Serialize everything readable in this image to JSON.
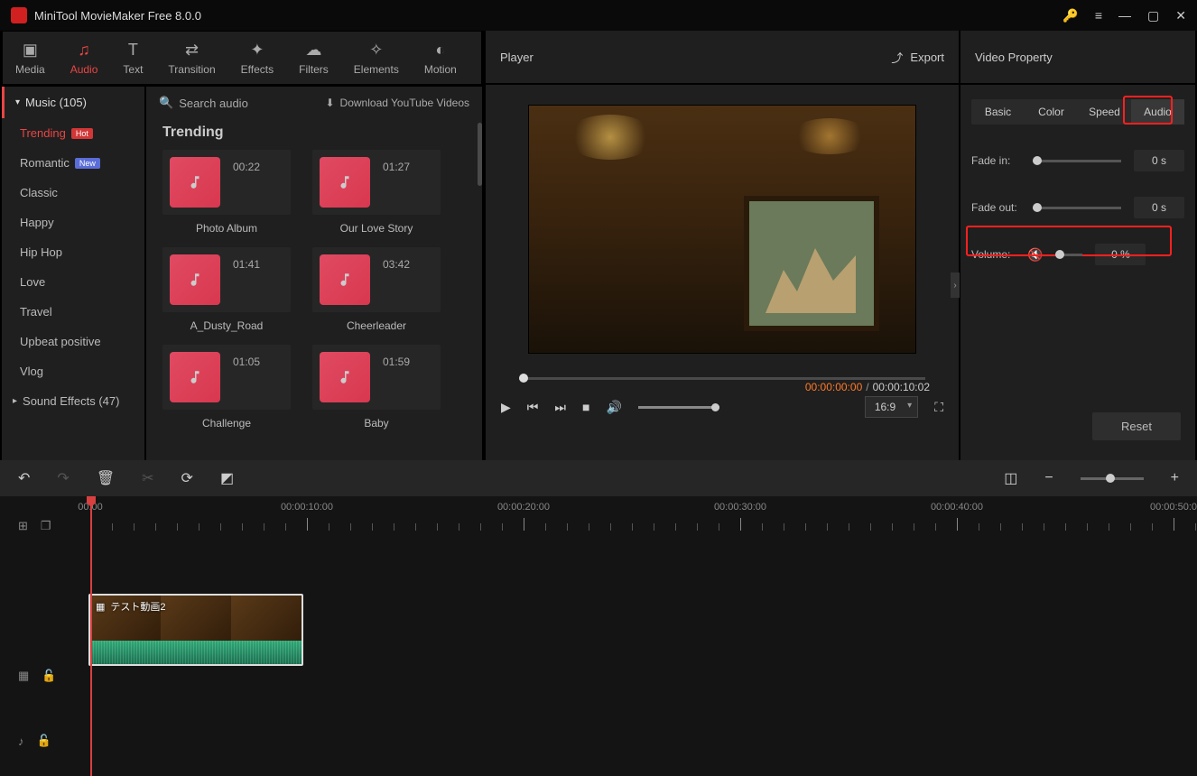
{
  "app": {
    "title": "MiniTool MovieMaker Free 8.0.0"
  },
  "topTabs": [
    {
      "key": "media",
      "label": "Media"
    },
    {
      "key": "audio",
      "label": "Audio"
    },
    {
      "key": "text",
      "label": "Text"
    },
    {
      "key": "transition",
      "label": "Transition"
    },
    {
      "key": "effects",
      "label": "Effects"
    },
    {
      "key": "filters",
      "label": "Filters"
    },
    {
      "key": "elements",
      "label": "Elements"
    },
    {
      "key": "motion",
      "label": "Motion"
    }
  ],
  "sidebar": {
    "header": "Music (105)",
    "items": [
      {
        "label": "Trending",
        "badge": "Hot"
      },
      {
        "label": "Romantic",
        "badge": "New"
      },
      {
        "label": "Classic"
      },
      {
        "label": "Happy"
      },
      {
        "label": "Hip Hop"
      },
      {
        "label": "Love"
      },
      {
        "label": "Travel"
      },
      {
        "label": "Upbeat positive"
      },
      {
        "label": "Vlog"
      }
    ],
    "footer": "Sound Effects (47)"
  },
  "content": {
    "search_placeholder": "Search audio",
    "download_label": "Download YouTube Videos",
    "section_title": "Trending",
    "clips": [
      {
        "name": "Photo Album",
        "dur": "00:22"
      },
      {
        "name": "Our Love Story",
        "dur": "01:27"
      },
      {
        "name": "A_Dusty_Road",
        "dur": "01:41"
      },
      {
        "name": "Cheerleader",
        "dur": "03:42"
      },
      {
        "name": "Challenge",
        "dur": "01:05"
      },
      {
        "name": "Baby",
        "dur": "01:59"
      }
    ]
  },
  "player": {
    "header": "Player",
    "export": "Export",
    "current_time": "00:00:00:00",
    "duration": "00:00:10:02",
    "aspect": "16:9"
  },
  "property": {
    "header": "Video Property",
    "tabs": [
      "Basic",
      "Color",
      "Speed",
      "Audio"
    ],
    "fade_in_label": "Fade in:",
    "fade_in_value": "0 s",
    "fade_out_label": "Fade out:",
    "fade_out_value": "0 s",
    "volume_label": "Volume:",
    "volume_value": "0 %",
    "reset": "Reset"
  },
  "timeline": {
    "labels": [
      "00:00",
      "00:00:10:00",
      "00:00:20:00",
      "00:00:30:00",
      "00:00:40:00",
      "00:00:50:0"
    ],
    "clip_name": "テスト動画2"
  }
}
